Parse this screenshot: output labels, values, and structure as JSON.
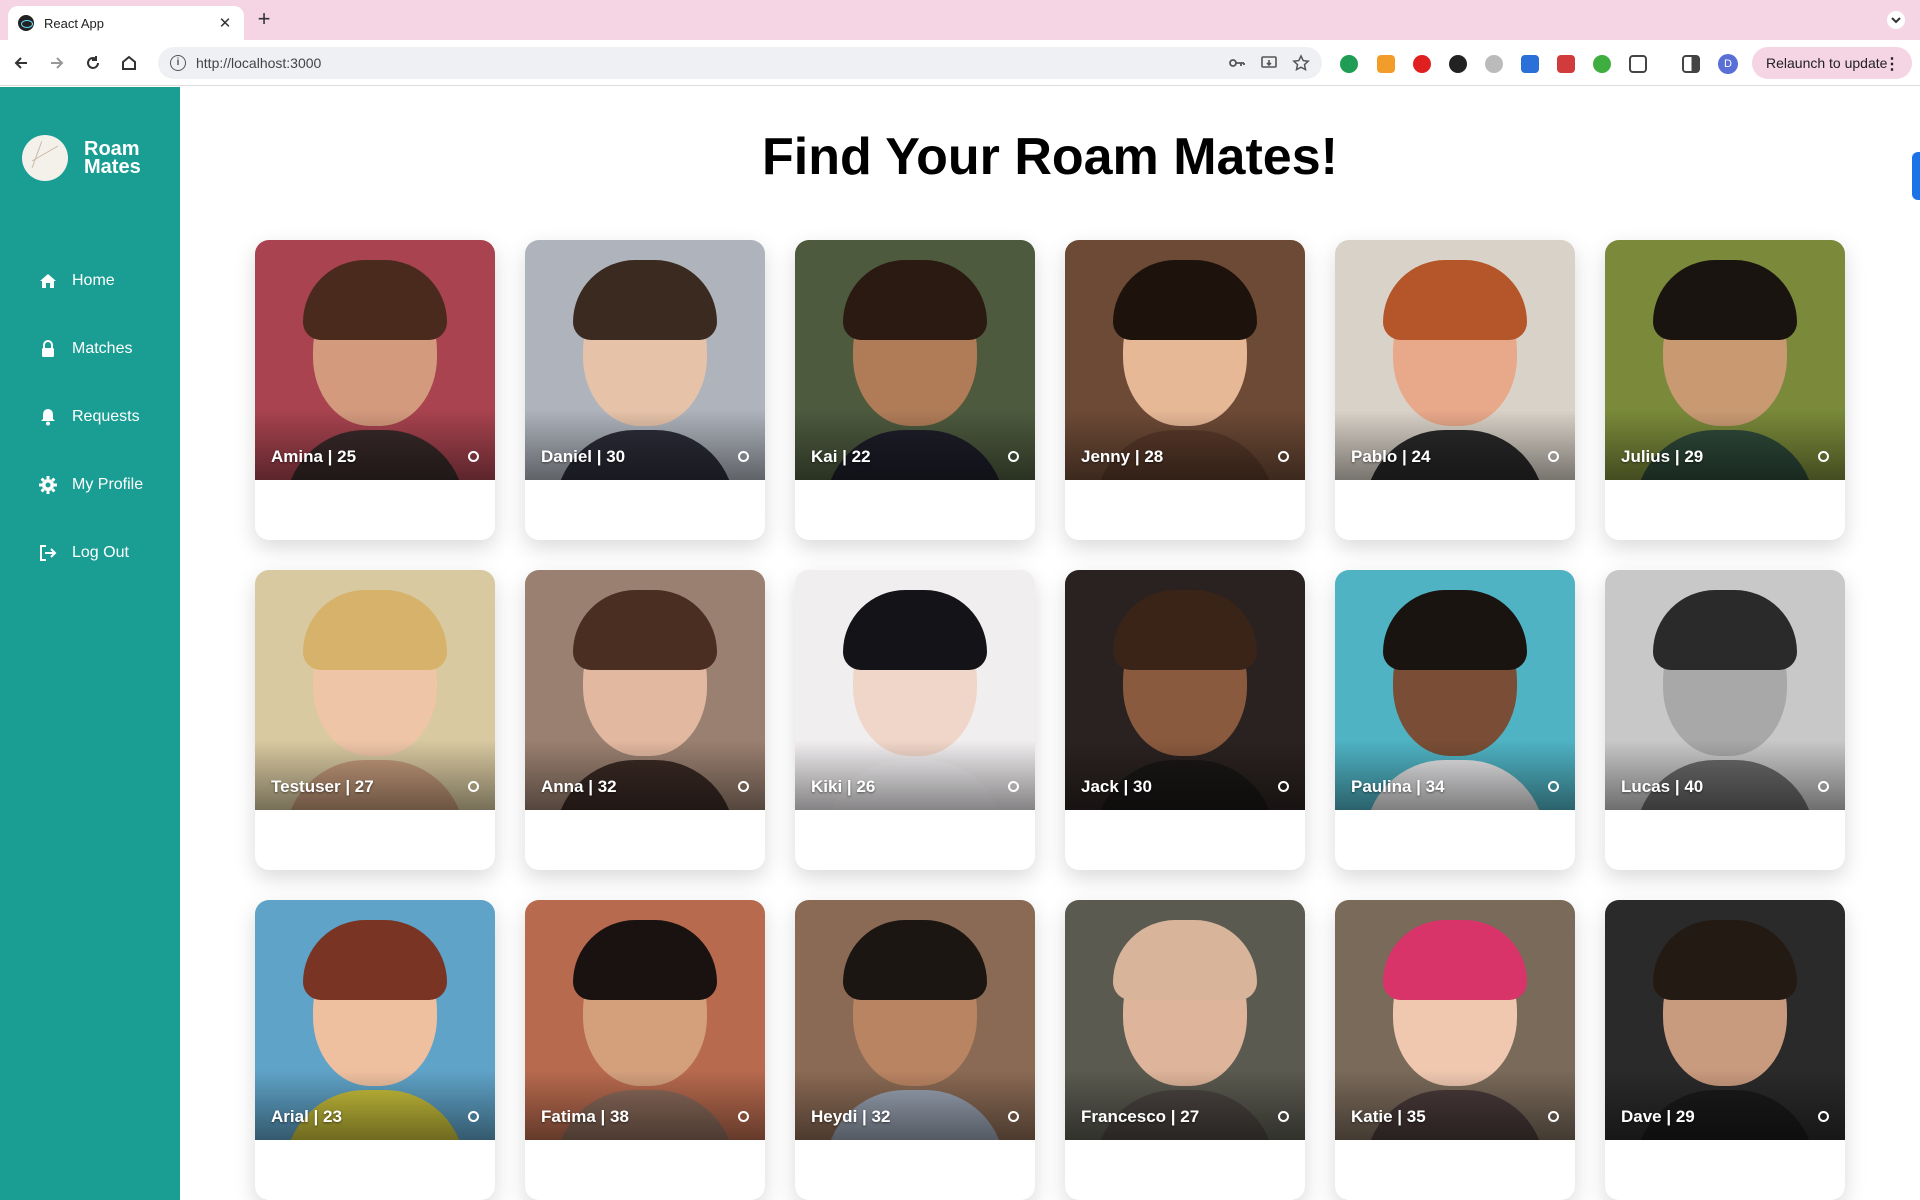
{
  "browser": {
    "tab_title": "React App",
    "url": "http://localhost:3000",
    "relaunch_label": "Relaunch to update",
    "profile_initial": "D"
  },
  "sidebar": {
    "brand": "Roam Mates",
    "items": [
      {
        "label": "Home",
        "icon": "home-icon"
      },
      {
        "label": "Matches",
        "icon": "lock-icon"
      },
      {
        "label": "Requests",
        "icon": "bell-icon"
      },
      {
        "label": "My Profile",
        "icon": "gear-icon"
      },
      {
        "label": "Log Out",
        "icon": "logout-icon"
      }
    ]
  },
  "page": {
    "title": "Find Your Roam Mates!"
  },
  "profiles": [
    {
      "caption": "Amina | 25",
      "bg": "#a8434f",
      "skin": "#d49a7e",
      "hair": "#4a2a1c",
      "shirt": "#3a2a2a"
    },
    {
      "caption": "Daniel | 30",
      "bg": "#aeb3bc",
      "skin": "#e6c2a8",
      "hair": "#3b2a20",
      "shirt": "#2d2d3a"
    },
    {
      "caption": "Kai | 22",
      "bg": "#4d5a3e",
      "skin": "#b07c58",
      "hair": "#2b1a12",
      "shirt": "#1e1e2a"
    },
    {
      "caption": "Jenny | 28",
      "bg": "#6d4a36",
      "skin": "#e6b896",
      "hair": "#1e120c",
      "shirt": "#5a3a2a"
    },
    {
      "caption": "Pablo | 24",
      "bg": "#d9d2c8",
      "skin": "#e8a88a",
      "hair": "#b4562a",
      "shirt": "#2a2a2a"
    },
    {
      "caption": "Julius | 29",
      "bg": "#7a8a3a",
      "skin": "#c99a72",
      "hair": "#1a1410",
      "shirt": "#2f4a3a"
    },
    {
      "caption": "Testuser | 27",
      "bg": "#d8c9a0",
      "skin": "#efc5a8",
      "hair": "#d6b26a",
      "shirt": "#c49a7a"
    },
    {
      "caption": "Anna | 32",
      "bg": "#9a8070",
      "skin": "#e2b8a0",
      "hair": "#4a2e22",
      "shirt": "#3a2a24"
    },
    {
      "caption": "Kiki | 26",
      "bg": "#f1eef0",
      "skin": "#f0d6c8",
      "hair": "#141418",
      "shirt": "#f4f2f4"
    },
    {
      "caption": "Jack | 30",
      "bg": "#2a2220",
      "skin": "#8a5a3e",
      "hair": "#3a2418",
      "shirt": "#1a1616"
    },
    {
      "caption": "Paulina | 34",
      "bg": "#4fb3c4",
      "skin": "#7a4e36",
      "hair": "#1a1410",
      "shirt": "#e6e6e8"
    },
    {
      "caption": "Lucas | 40",
      "bg": "#c8c8c8",
      "skin": "#a8a8a8",
      "hair": "#2a2a2a",
      "shirt": "#6a6a6a"
    },
    {
      "caption": "Arial | 23",
      "bg": "#5fa3c8",
      "skin": "#efc0a0",
      "hair": "#7a3424",
      "shirt": "#c9c03a"
    },
    {
      "caption": "Fatima | 38",
      "bg": "#b86a4e",
      "skin": "#d4a07c",
      "hair": "#1a1210",
      "shirt": "#8a6a5a"
    },
    {
      "caption": "Heydi | 32",
      "bg": "#8a6a54",
      "skin": "#b98462",
      "hair": "#1c1612",
      "shirt": "#9aa4b4"
    },
    {
      "caption": "Francesco | 27",
      "bg": "#5a5a50",
      "skin": "#deb49a",
      "hair": "#d8b49a",
      "shirt": "#4a4440"
    },
    {
      "caption": "Katie | 35",
      "bg": "#7a6a5a",
      "skin": "#f0c8b0",
      "hair": "#d8346a",
      "shirt": "#4a3a3a"
    },
    {
      "caption": "Dave | 29",
      "bg": "#2a2a2a",
      "skin": "#c89a7e",
      "hair": "#241a14",
      "shirt": "#1a1a1a"
    }
  ]
}
